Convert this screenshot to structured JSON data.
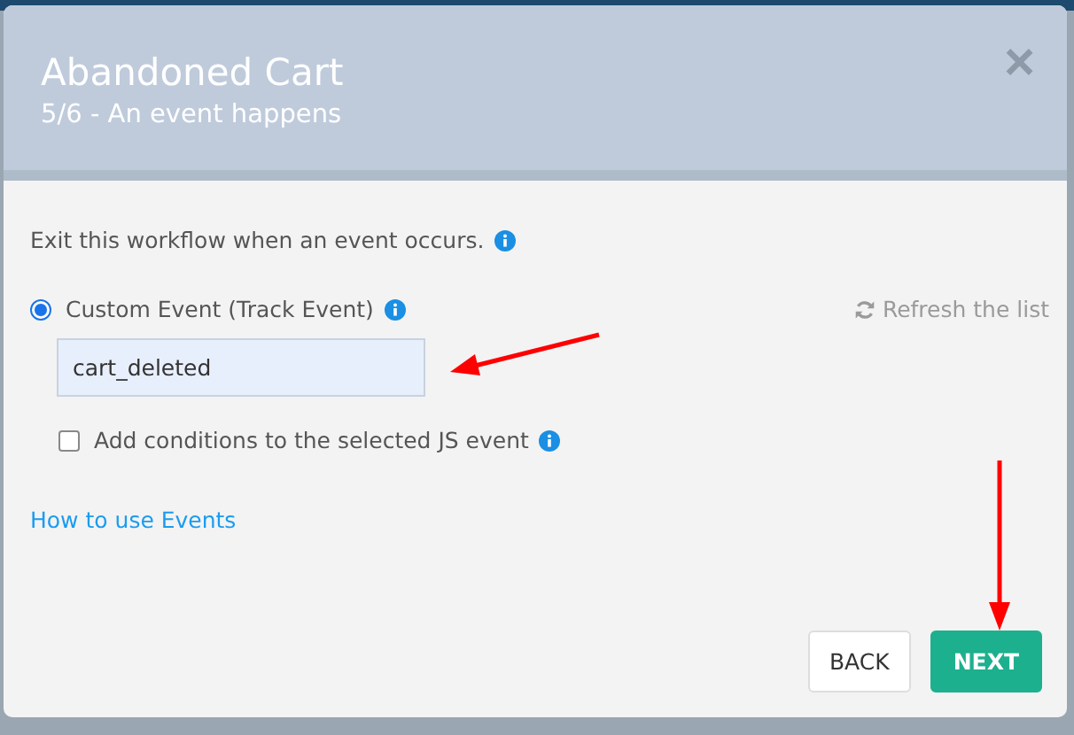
{
  "dialog": {
    "title": "Abandoned Cart",
    "subtitle": "5/6 - An event happens",
    "close": "×"
  },
  "intro": "Exit this workflow when an event occurs.",
  "event_option": {
    "label": "Custom Event (Track Event)",
    "selected": true
  },
  "refresh": "Refresh the list",
  "event_field": {
    "value": "cart_deleted"
  },
  "conditions": {
    "label": "Add conditions to the selected JS event",
    "checked": false
  },
  "help_link": "How to use Events",
  "buttons": [
    {
      "label": "BACK",
      "kind": "secondary"
    },
    {
      "label": "NEXT",
      "kind": "primary"
    }
  ]
}
